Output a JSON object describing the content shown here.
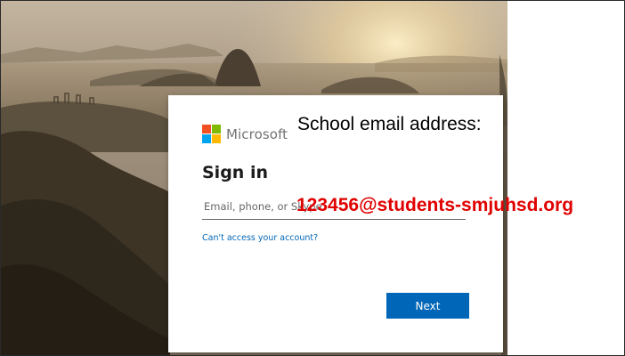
{
  "colors": {
    "accent_blue": "#0067b8",
    "annotation_red": "#e00000",
    "logo_red": "#f25022",
    "logo_green": "#7fba00",
    "logo_blue": "#00a4ef",
    "logo_yellow": "#ffb900"
  },
  "background": {
    "image_subject": "sunset-over-rio-mountains"
  },
  "signin": {
    "brand": "Microsoft",
    "logo_icon": "microsoft-logo-icon",
    "title": "Sign in",
    "email_placeholder": "Email, phone, or Skype",
    "help_link": "Can't access your account?",
    "next_label": "Next"
  },
  "annotation": {
    "label": "School email address:",
    "example_email": "123456@students-smjuhsd.org"
  }
}
